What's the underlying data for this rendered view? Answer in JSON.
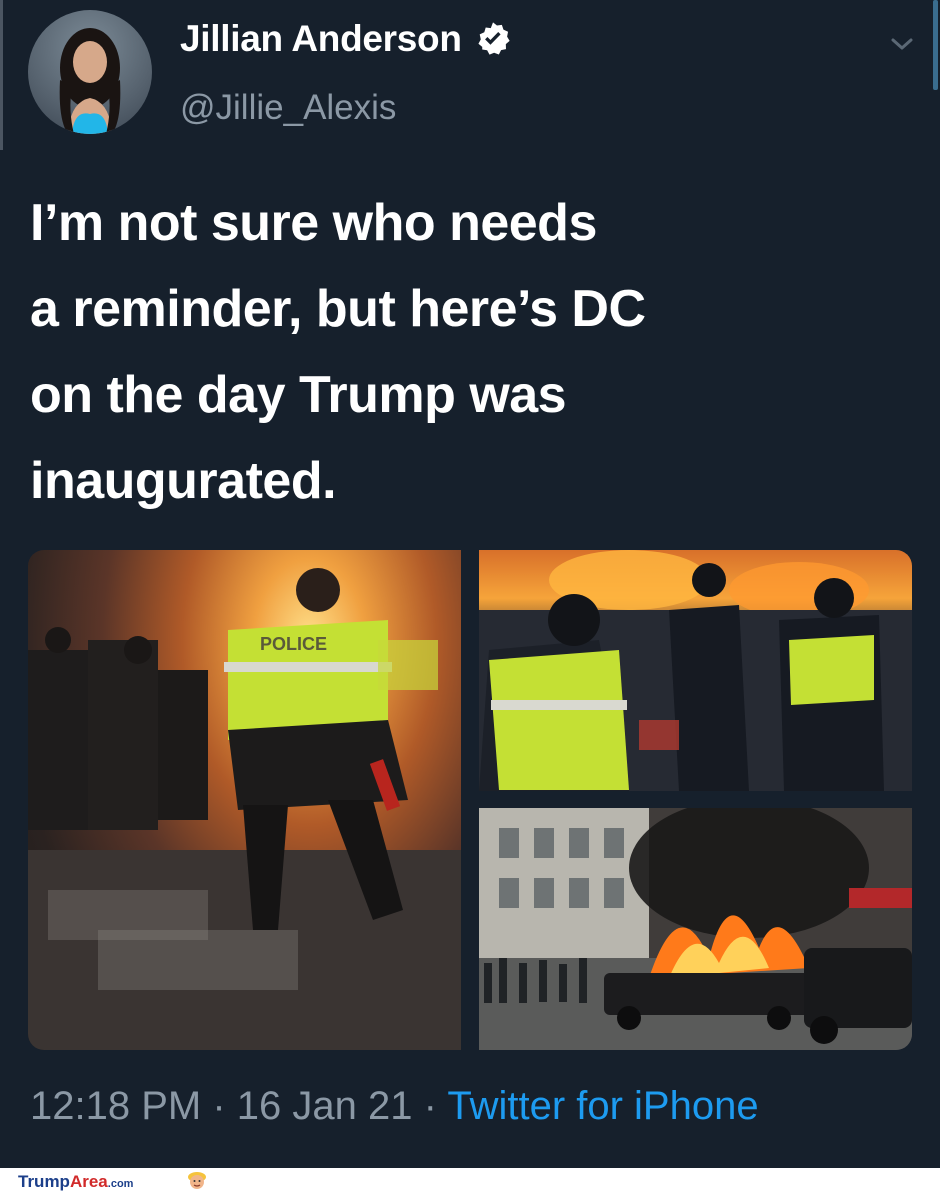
{
  "user": {
    "display_name": "Jillian Anderson",
    "handle": "@Jillie_Alexis",
    "verified": true
  },
  "icons": {
    "verified": "verified-badge-icon",
    "more": "chevron-down-icon"
  },
  "tweet": {
    "lines": [
      "I’m not sure who needs",
      "a reminder, but here’s DC",
      "on the day Trump was",
      "inaugurated."
    ],
    "photo_badge": "POLICE"
  },
  "meta": {
    "time": "12:18 PM",
    "separator": "·",
    "date": "16 Jan 21",
    "source": "Twitter for iPhone"
  },
  "watermark": {
    "part1": "Trump",
    "part2": "Area",
    "part3": ".com"
  },
  "colors": {
    "background": "#16202c",
    "text": "#ffffff",
    "secondary": "#8b98a5",
    "link": "#1d9bf0"
  }
}
